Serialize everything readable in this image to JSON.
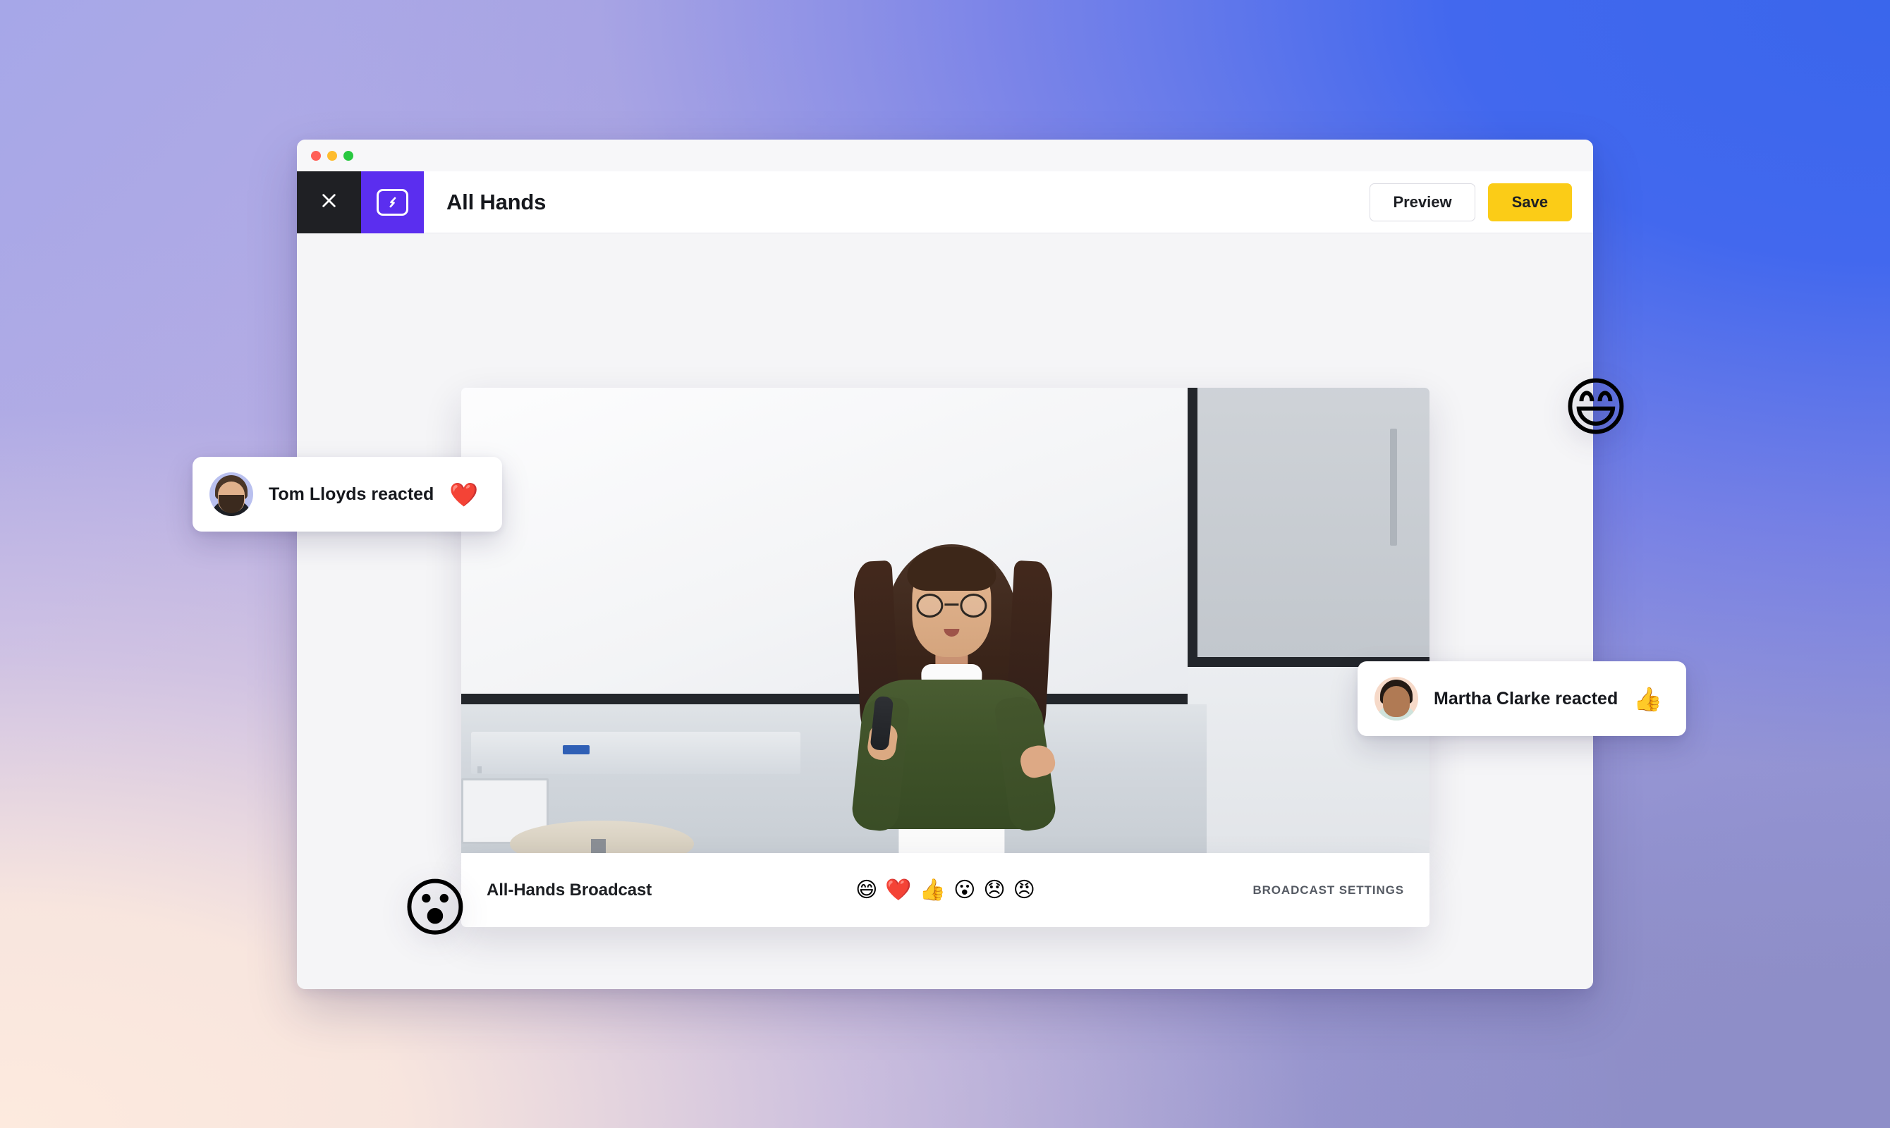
{
  "window": {
    "traffic_lights": [
      "close",
      "minimize",
      "maximize"
    ],
    "colors": {
      "close": "#ff5f57",
      "minimize": "#febc2e",
      "maximize": "#28c840"
    }
  },
  "toolbar": {
    "close_label": "×",
    "close_icon": "close-x-icon",
    "brand_icon": "lightning-screen-icon",
    "brand_color": "#5b2eef",
    "title": "All Hands",
    "preview_label": "Preview",
    "save_label": "Save",
    "save_color": "#fbcc17"
  },
  "player": {
    "bar_title": "All-Hands Broadcast",
    "settings_label": "BROADCAST SETTINGS",
    "reactions": [
      {
        "name": "grinning-face-emoji",
        "glyph": "😄"
      },
      {
        "name": "red-heart-emoji",
        "glyph": "❤️"
      },
      {
        "name": "thumbs-up-emoji",
        "glyph": "👍"
      },
      {
        "name": "surprised-face-emoji",
        "glyph": "😮"
      },
      {
        "name": "disappointed-face-emoji",
        "glyph": "😞"
      },
      {
        "name": "angry-face-emoji",
        "glyph": "😠"
      }
    ]
  },
  "toasts": [
    {
      "name": "tom-lloyds",
      "text": "Tom Lloyds reacted",
      "emoji": "❤️",
      "emoji_name": "red-heart-emoji"
    },
    {
      "name": "martha-clarke",
      "text": "Martha Clarke reacted",
      "emoji": "👍",
      "emoji_name": "thumbs-up-emoji"
    }
  ],
  "floating_emojis": [
    {
      "name": "grinning-face-emoji",
      "glyph": "😄"
    },
    {
      "name": "surprised-face-emoji",
      "glyph": "😮"
    }
  ]
}
